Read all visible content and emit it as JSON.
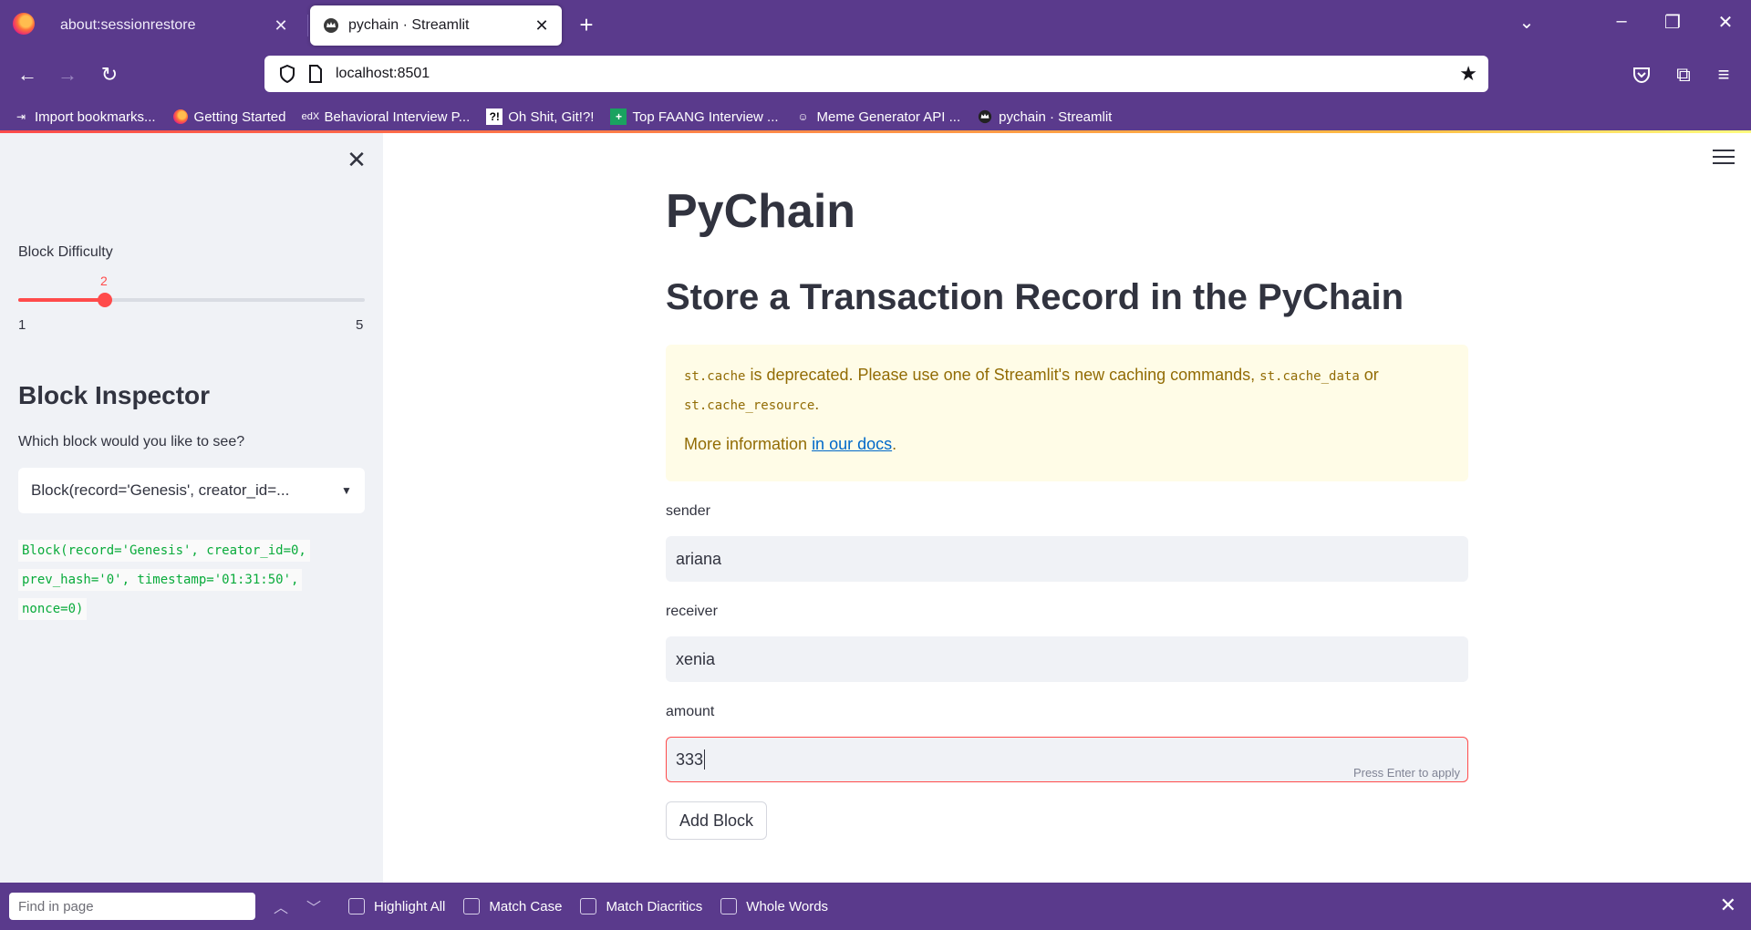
{
  "browser": {
    "tabs": [
      {
        "label": "about:sessionrestore"
      },
      {
        "label": "pychain · Streamlit"
      }
    ],
    "url": "localhost:8501",
    "bookmarks": [
      {
        "label": "Import bookmarks..."
      },
      {
        "label": "Getting Started"
      },
      {
        "label": "Behavioral Interview P..."
      },
      {
        "label": "Oh Shit, Git!?!"
      },
      {
        "label": "Top FAANG Interview ..."
      },
      {
        "label": "Meme Generator API ..."
      },
      {
        "label": "pychain · Streamlit"
      }
    ]
  },
  "sidebar": {
    "slider": {
      "label": "Block Difficulty",
      "value": "2",
      "min": "1",
      "max": "5",
      "fraction": 0.25
    },
    "inspector_title": "Block Inspector",
    "select_label": "Which block would you like to see?",
    "select_value": "Block(record='Genesis', creator_id=...",
    "code_lines": [
      "Block(record='Genesis', creator_id=0,",
      "prev_hash='0', timestamp='01:31:50',",
      "nonce=0)"
    ]
  },
  "main": {
    "title": "PyChain",
    "subtitle": "Store a Transaction Record in the PyChain",
    "warning": {
      "code1": "st.cache",
      "text1": " is deprecated. Please use one of Streamlit's new caching commands, ",
      "code2": "st.cache_data",
      "text2": " or ",
      "code3": "st.cache_resource",
      "text3": ".",
      "more": "More information ",
      "link": "in our docs",
      "end": "."
    },
    "fields": [
      {
        "label": "sender",
        "value": "ariana"
      },
      {
        "label": "receiver",
        "value": "xenia"
      },
      {
        "label": "amount",
        "value": "333",
        "hint": "Press Enter to apply"
      }
    ],
    "button": "Add Block"
  },
  "findbar": {
    "placeholder": "Find in page",
    "options": [
      "Highlight All",
      "Match Case",
      "Match Diacritics",
      "Whole Words"
    ]
  },
  "colors": {
    "accent": "#ff4b4b",
    "chrome": "#5a3a8c",
    "code_green": "#09ab3b",
    "warning_text": "#926c05"
  }
}
